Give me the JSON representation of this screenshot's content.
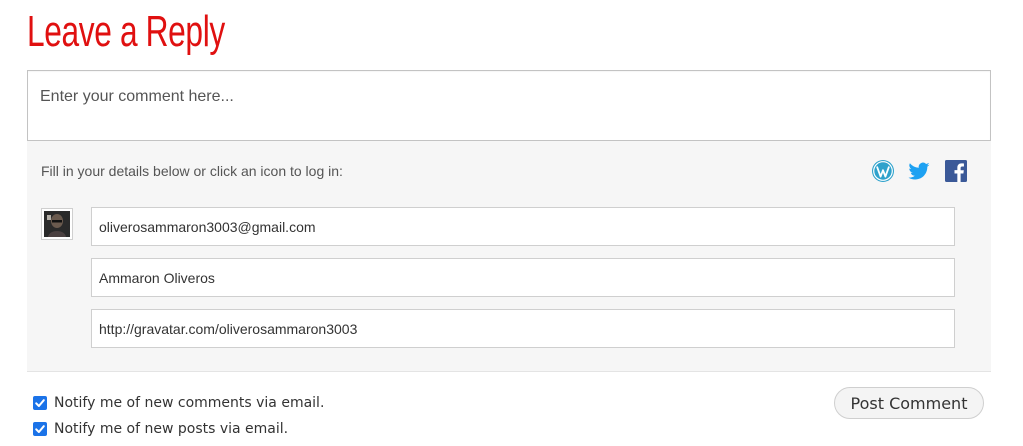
{
  "heading": "Leave a Reply",
  "comment": {
    "placeholder": "Enter your comment here..."
  },
  "details": {
    "prompt": "Fill in your details below or click an icon to log in:",
    "login_icons": [
      "wordpress-icon",
      "twitter-icon",
      "facebook-icon"
    ],
    "email": "oliverosammaron3003@gmail.com",
    "name": "Ammaron Oliveros",
    "website": "http://gravatar.com/oliverosammaron3003"
  },
  "options": {
    "notify_comments": {
      "label": "Notify me of new comments via email.",
      "checked": true
    },
    "notify_posts": {
      "label": "Notify me of new posts via email.",
      "checked": true
    }
  },
  "submit_label": "Post Comment",
  "colors": {
    "heading": "#e01010",
    "social_blue": "#2ea2cc",
    "twitter": "#1da1f2",
    "facebook": "#3b5998",
    "checkbox": "#1b73e8"
  }
}
